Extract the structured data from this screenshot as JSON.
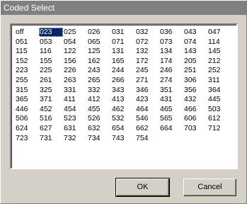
{
  "window": {
    "title": "Coded Select"
  },
  "codes": [
    [
      "off",
      "023",
      "025",
      "026",
      "031",
      "032",
      "036",
      "043",
      "047"
    ],
    [
      "051",
      "053",
      "054",
      "065",
      "071",
      "072",
      "073",
      "074",
      "114"
    ],
    [
      "115",
      "116",
      "122",
      "125",
      "131",
      "132",
      "134",
      "143",
      "145"
    ],
    [
      "152",
      "155",
      "156",
      "162",
      "165",
      "172",
      "174",
      "205",
      "212"
    ],
    [
      "223",
      "225",
      "226",
      "243",
      "244",
      "245",
      "246",
      "251",
      "252"
    ],
    [
      "255",
      "261",
      "263",
      "265",
      "266",
      "271",
      "274",
      "306",
      "311"
    ],
    [
      "315",
      "325",
      "331",
      "332",
      "343",
      "346",
      "351",
      "356",
      "364"
    ],
    [
      "365",
      "371",
      "411",
      "412",
      "413",
      "423",
      "431",
      "432",
      "445"
    ],
    [
      "446",
      "452",
      "454",
      "455",
      "462",
      "464",
      "465",
      "466",
      "503"
    ],
    [
      "506",
      "516",
      "523",
      "526",
      "532",
      "546",
      "565",
      "606",
      "612"
    ],
    [
      "624",
      "627",
      "631",
      "632",
      "654",
      "662",
      "664",
      "703",
      "712"
    ],
    [
      "723",
      "731",
      "732",
      "734",
      "743",
      "754"
    ]
  ],
  "selected": "023",
  "buttons": {
    "ok_label": "OK",
    "cancel_label": "Cancel"
  },
  "colors": {
    "title_bg": "#808080",
    "selection_bg": "#0a246a",
    "window_bg": "#d4d0c8"
  }
}
